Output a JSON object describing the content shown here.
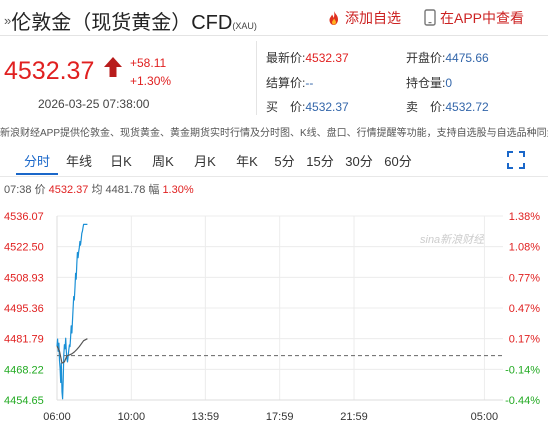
{
  "header": {
    "prefix": "»",
    "title": "伦敦金（现货黄金）CFD",
    "ticker": "(XAU)",
    "add_favorite": "添加自选",
    "app_view": "在APP中查看"
  },
  "quote": {
    "price": "4532.37",
    "change": "+58.11",
    "change_pct": "+1.30%",
    "timestamp": "2026-03-25 07:38:00",
    "stats": {
      "latest_label": "最新价:",
      "latest": "4532.37",
      "open_label": "开盘价:",
      "open": "4475.66",
      "settle_label": "结算价:",
      "settle": "--",
      "position_label": "持仓量:",
      "position": "0",
      "buy_label": "买　价:",
      "buy": "4532.37",
      "sell_label": "卖　价:",
      "sell": "4532.72"
    }
  },
  "notice": "新浪财经APP提供伦敦金、现货黄金、黄金期货实时行情及分时图、K线、盘口、行情提醒等功能，支持自选股与自选品种同步",
  "tabs": [
    "分时",
    "年线",
    "日K",
    "周K",
    "月K",
    "年K",
    "5分",
    "15分",
    "30分",
    "60分"
  ],
  "active_tab": "分时",
  "infoline": {
    "time": "07:38",
    "price_label": "价",
    "price": "4532.37",
    "avg_label": "均",
    "avg": "4481.78",
    "amp_label": "幅",
    "amp": "1.30%"
  },
  "watermark": "sina新浪财经",
  "colors": {
    "up": "#e02020",
    "down": "#22aa22",
    "line": "#1a90d6",
    "avg": "#555555",
    "accent": "#1a67c9"
  },
  "chart_data": {
    "type": "line",
    "prev_close": 4474.26,
    "y_ticks": [
      "4536.07",
      "4522.50",
      "4508.93",
      "4495.36",
      "4481.79",
      "4468.22",
      "4454.65"
    ],
    "pct_ticks": [
      "1.38%",
      "1.08%",
      "0.77%",
      "0.47%",
      "0.17%",
      "-0.14%",
      "-0.44%"
    ],
    "ylim": [
      4454.65,
      4536.07
    ],
    "x_labels": [
      "06:00",
      "10:00",
      "13:59",
      "17:59",
      "21:59",
      "05:00"
    ],
    "x_range": [
      0,
      1440
    ],
    "label_positions_min": [
      0,
      240,
      479,
      719,
      959,
      1380
    ],
    "series": [
      {
        "x": [
          0,
          2,
          4,
          6,
          8,
          10,
          12,
          14,
          16,
          18,
          20,
          22,
          24,
          26,
          28,
          30,
          32,
          34,
          36,
          38,
          40,
          42,
          44,
          46,
          48,
          50,
          52,
          54,
          56,
          58,
          60,
          62,
          64,
          66,
          68,
          70,
          72,
          74,
          76,
          78,
          80,
          82,
          84,
          86,
          98
        ],
        "y": [
          4478.5,
          4481.6,
          4476.2,
          4479.8,
          4472.1,
          4468.7,
          4462.4,
          4470.9,
          4458.3,
          4455.2,
          4463.5,
          4474.6,
          4479.1,
          4477.3,
          4482.0,
          4476.4,
          4473.0,
          4471.5,
          4474.2,
          4476.8,
          4479.0,
          4478.3,
          4482.4,
          4487.5,
          4484.3,
          4489.9,
          4495.2,
          4500.4,
          4498.9,
          4504.6,
          4510.7,
          4508.1,
          4514.8,
          4519.9,
          4517.6,
          4520.3,
          4522.1,
          4524.8,
          4523.2,
          4525.7,
          4528.4,
          4529.3,
          4530.9,
          4532.37,
          4532.37
        ]
      },
      {
        "name": "均",
        "x": [
          0,
          8,
          16,
          24,
          32,
          40,
          48,
          56,
          64,
          72,
          80,
          86,
          98
        ],
        "y": [
          4478.5,
          4476.2,
          4471.0,
          4471.5,
          4474.2,
          4474.6,
          4475.1,
          4475.9,
          4477.0,
          4478.3,
          4479.8,
          4480.9,
          4481.78
        ]
      }
    ]
  }
}
